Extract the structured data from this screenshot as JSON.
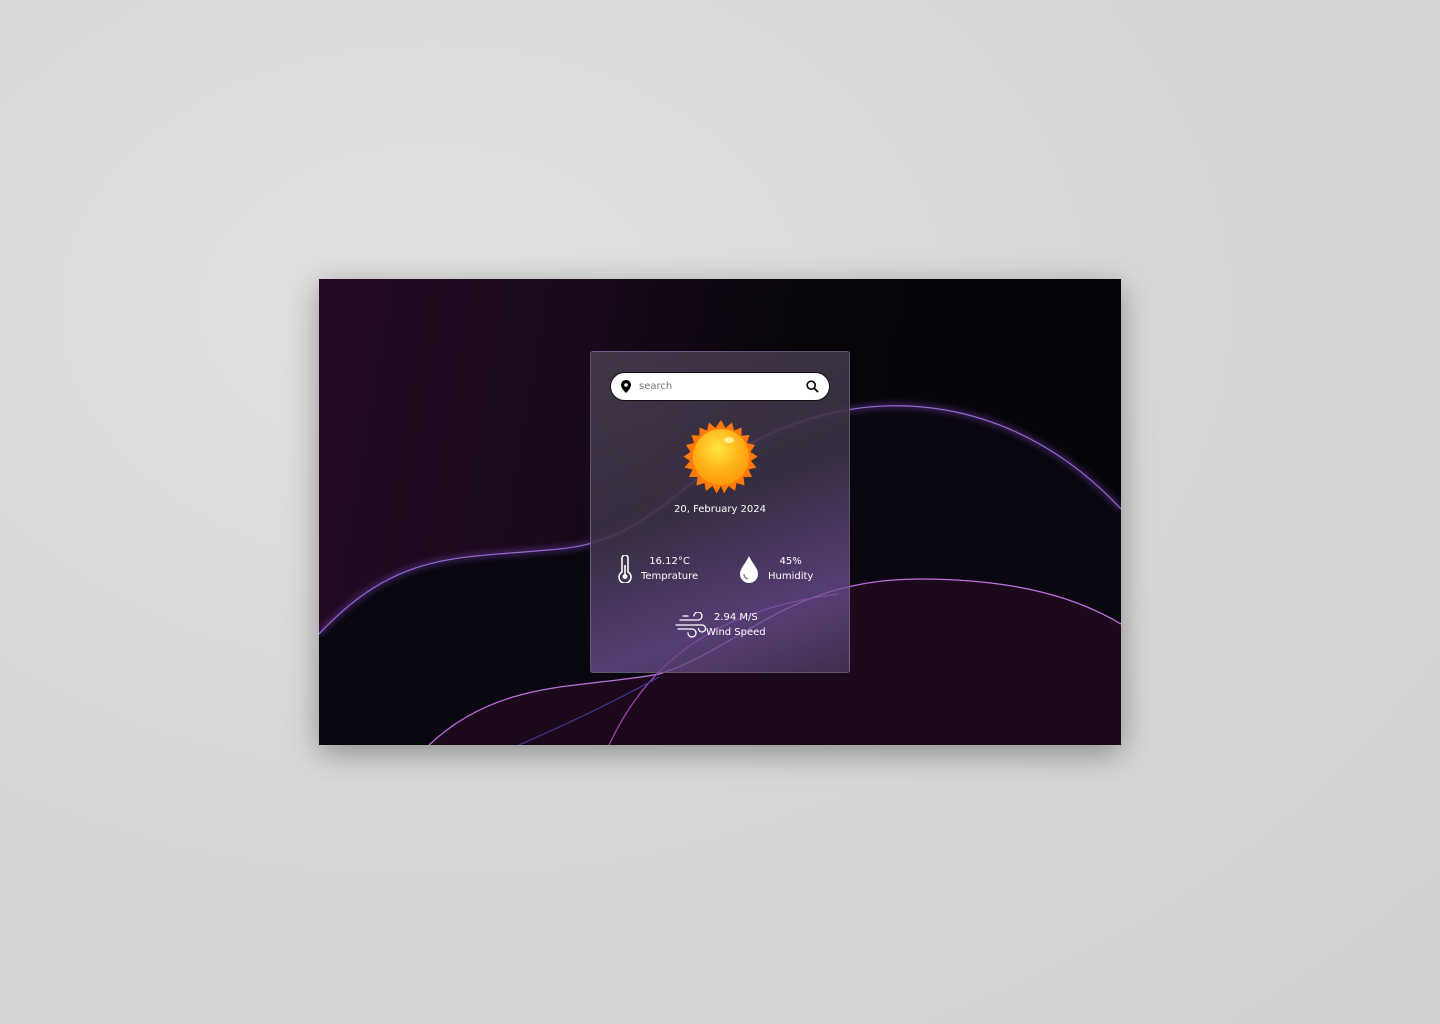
{
  "search": {
    "placeholder": "search"
  },
  "weather": {
    "date": "20, February 2024",
    "temperature": {
      "value": "16.12°C",
      "label": "Temprature"
    },
    "humidity": {
      "value": "45%",
      "label": "Humidity"
    },
    "wind": {
      "value": "2.94 M/S",
      "label": "Wind Speed"
    }
  }
}
